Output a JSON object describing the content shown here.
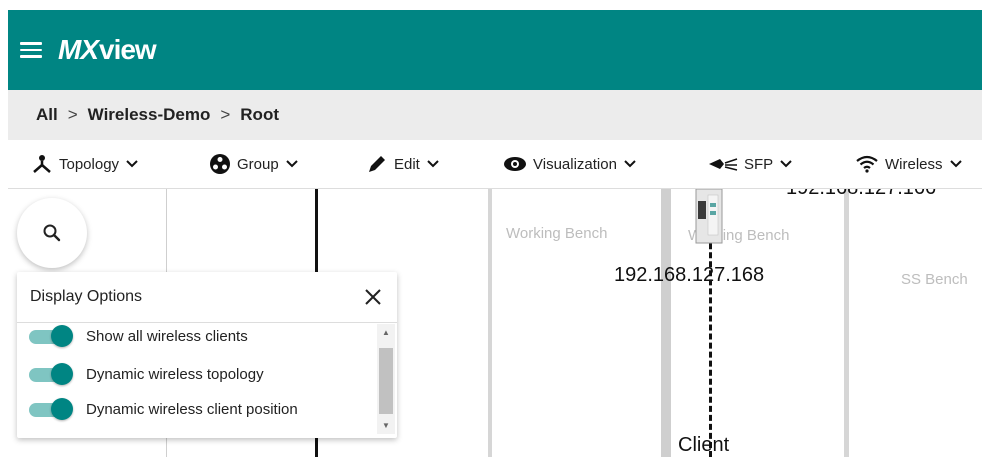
{
  "app": {
    "logo_mx": "MX",
    "logo_view": "view"
  },
  "breadcrumb": {
    "items": [
      "All",
      "Wireless-Demo",
      "Root"
    ],
    "separator": ">"
  },
  "toolbar": {
    "topology": "Topology",
    "group": "Group",
    "edit": "Edit",
    "visualization": "Visualization",
    "sfp": "SFP",
    "wireless": "Wireless"
  },
  "canvas": {
    "bench_working_1": "Working Bench",
    "bench_working_2": "Working Bench",
    "bench_ss": "SS Bench",
    "ip_top": "192.168.127.166",
    "ip_device": "192.168.127.168",
    "client_label": "Client"
  },
  "display_options": {
    "title": "Display Options",
    "options": [
      {
        "label": "Show all wireless clients",
        "enabled": true
      },
      {
        "label": "Dynamic wireless topology",
        "enabled": true
      },
      {
        "label": "Dynamic wireless client position",
        "enabled": true
      }
    ]
  },
  "colors": {
    "brand": "#008583",
    "toggle_track": "#7fc5c2",
    "breadcrumb_bg": "#ececec"
  },
  "icons": {
    "menu": "hamburger-icon",
    "search": "search-icon",
    "close": "close-icon",
    "topology": "topology-icon",
    "group": "group-icon",
    "edit": "pencil-icon",
    "visualization": "eye-icon",
    "sfp": "sfp-icon",
    "wireless": "wifi-icon",
    "dropdown": "chevron-down-icon"
  }
}
